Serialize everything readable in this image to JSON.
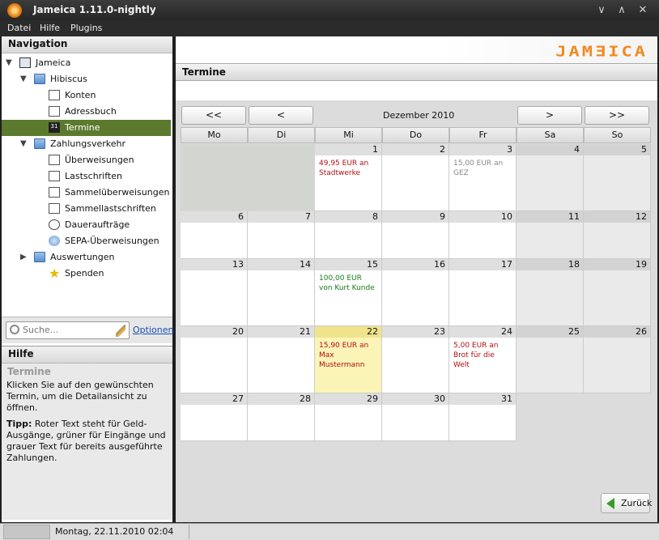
{
  "window": {
    "title": "Jameica 1.11.0-nightly",
    "controls": [
      "∨",
      "∧",
      "✕"
    ]
  },
  "menu": [
    "Datei",
    "Hilfe",
    "Plugins"
  ],
  "nav": {
    "title": "Navigation",
    "items": [
      {
        "label": "Jameica",
        "icon": "computer-icon",
        "expander": "▼"
      },
      {
        "label": "Hibiscus",
        "icon": "folder-icon",
        "expander": "▼"
      },
      {
        "label": "Konten",
        "icon": "accounts-icon"
      },
      {
        "label": "Adressbuch",
        "icon": "addressbook-icon"
      },
      {
        "label": "Termine",
        "icon": "calendar-icon",
        "selected": true
      },
      {
        "label": "Zahlungsverkehr",
        "icon": "folder-icon",
        "expander": "▼"
      },
      {
        "label": "Überweisungen",
        "icon": "transfer-icon"
      },
      {
        "label": "Lastschriften",
        "icon": "debit-icon"
      },
      {
        "label": "Sammelüberweisungen",
        "icon": "collective-transfer-icon"
      },
      {
        "label": "Sammellastschriften",
        "icon": "collective-debit-icon"
      },
      {
        "label": "Daueraufträge",
        "icon": "clock-icon"
      },
      {
        "label": "SEPA-Überweisungen",
        "icon": "sepa-icon"
      },
      {
        "label": "Auswertungen",
        "icon": "folder-icon",
        "expander": "▶"
      },
      {
        "label": "Spenden",
        "icon": "star-icon"
      }
    ],
    "search_placeholder": "Suche...",
    "options": "Optionen"
  },
  "help": {
    "title": "Hilfe",
    "subtitle": "Termine",
    "text1": "Klicken Sie auf den gewünschten Termin, um die Detailansicht zu öffnen.",
    "tip_label": "Tipp:",
    "tip_text": " Roter Text steht für Geld-Ausgänge, grüner für Eingänge und grauer Text für bereits ausgeführte Zahlungen."
  },
  "main": {
    "title": "Termine",
    "logo": "JAMƎICA",
    "month": "Dezember 2010",
    "nav_buttons": {
      "first": "<<",
      "prev": "<",
      "next": ">",
      "last": ">>"
    },
    "weekdays": [
      "Mo",
      "Di",
      "Mi",
      "Do",
      "Fr",
      "Sa",
      "So"
    ],
    "back_label": "Zurück"
  },
  "calendar": {
    "colors": {
      "out": "#b01010",
      "in": "#1a7a1a",
      "done": "#888888"
    },
    "weeks": [
      [
        null,
        null,
        {
          "d": 1,
          "ev": "49,95 EUR an Stadtwerke",
          "t": "out"
        },
        {
          "d": 2
        },
        {
          "d": 3,
          "ev": "15,00 EUR an GEZ",
          "t": "done"
        },
        {
          "d": 4
        },
        {
          "d": 5
        }
      ],
      [
        {
          "d": 6
        },
        {
          "d": 7
        },
        {
          "d": 8
        },
        {
          "d": 9
        },
        {
          "d": 10
        },
        {
          "d": 11
        },
        {
          "d": 12
        }
      ],
      [
        {
          "d": 13
        },
        {
          "d": 14
        },
        {
          "d": 15,
          "ev": "100,00 EUR von Kurt Kunde",
          "t": "in"
        },
        {
          "d": 16
        },
        {
          "d": 17
        },
        {
          "d": 18
        },
        {
          "d": 19
        }
      ],
      [
        {
          "d": 20
        },
        {
          "d": 21
        },
        {
          "d": 22,
          "ev": "15,90 EUR an Max Mustermann",
          "t": "out",
          "today": true
        },
        {
          "d": 23
        },
        {
          "d": 24,
          "ev": "5,00 EUR an Brot für die Welt",
          "t": "out"
        },
        {
          "d": 25
        },
        {
          "d": 26
        }
      ],
      [
        {
          "d": 27
        },
        {
          "d": 28
        },
        {
          "d": 29
        },
        {
          "d": 30
        },
        {
          "d": 31
        },
        null,
        null
      ]
    ]
  },
  "status": {
    "text": "Montag, 22.11.2010 02:04"
  }
}
